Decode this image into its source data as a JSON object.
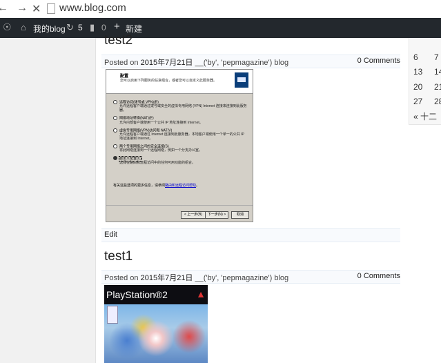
{
  "browser": {
    "back_glyph": "←",
    "forward_glyph": "→",
    "close_glyph": "✕",
    "url": "www.blog.com"
  },
  "admin_bar": {
    "site_name": "我的blog",
    "updates_count": "5",
    "comments_count": "0",
    "new_label": "新建",
    "bg_color": "#23282d"
  },
  "posts": [
    {
      "title": "test2",
      "posted_on": "Posted on",
      "date": "2015年7月21日",
      "author_meta": "__('by', 'pepmagazine')",
      "category": "blog",
      "comments": "0 Comments",
      "edit": "Edit",
      "image": {
        "kind": "windows-dialog-screenshot",
        "heading": "配置",
        "subheading": "您可以启用下列服务的任意组合，或者您可以自定义此服务器。",
        "options": [
          {
            "label": "远程访问(拨号或 VPN)(R)",
            "desc": "允许远程客户端通过拨号或安全的虚拟专用网络 (VPN) Internet 连接来连接到此服务器。"
          },
          {
            "label": "网络地址转换(NAT)(E)",
            "desc": "允许内部客户端使用一个公共 IP 地址连接到 Internet。"
          },
          {
            "label": "虚拟专用网络(VPN)访问和 NAT(V)",
            "desc": "允许远程客户端通过 Internet 连接到此服务器，本地客户端使用一个单一的公共 IP 地址连接到 Internet。"
          },
          {
            "label": "两个专用网络之间的安全连接(S)",
            "desc": "将此网络连接到一个远程网络，例如一个分支办公室。"
          },
          {
            "label": "自定义配置(C)",
            "desc": "选择在路由和远程访问中的任何可用功能的组合。"
          }
        ],
        "hint_prefix": "有关这些选项的更多信息，请参阅",
        "hint_link": "路由和远程访问帮助",
        "hint_suffix": "。",
        "btn_back": "< 上一步(B)",
        "btn_next": "下一步(N) >",
        "btn_cancel": "取消"
      }
    },
    {
      "title": "test1",
      "posted_on": "Posted on",
      "date": "2015年7月21日",
      "author_meta": "__('by', 'pepmagazine')",
      "category": "blog",
      "comments": "0 Comments",
      "image": {
        "kind": "ps2-game-cover",
        "logo_text": "PlayStation®2"
      }
    }
  ],
  "calendar": {
    "cells": [
      "6",
      "7",
      "13",
      "14",
      "20",
      "21",
      "27",
      "28"
    ],
    "prev_label": "« 十二"
  }
}
